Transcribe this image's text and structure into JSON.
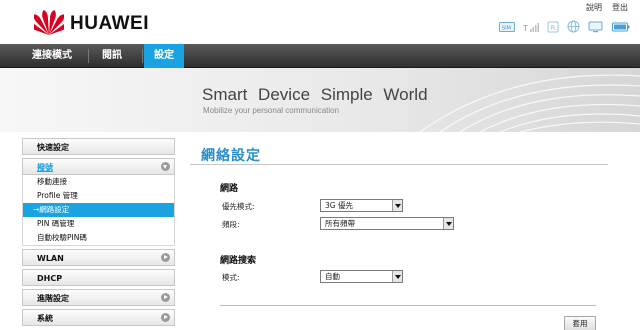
{
  "brand": {
    "name": "HUAWEI",
    "logo_icon": "huawei-petal-logo",
    "logo_color": "#d7001e"
  },
  "top_links": {
    "help": "說明",
    "logout": "登出"
  },
  "status_icons": [
    "sim-icon",
    "signal-icon",
    "roaming-icon",
    "globe-icon",
    "monitor-icon",
    "battery-icon"
  ],
  "nav": {
    "tabs": [
      "連接模式",
      "閱訊",
      "設定"
    ],
    "active": "設定",
    "active_color": "#1aa3e0"
  },
  "banner": {
    "title": "Smart Device   Simple World",
    "subtitle": "Mobilize your personal communication"
  },
  "sidebar": {
    "quick_setup": "快速設定",
    "dialup": {
      "label": "撥號",
      "items": [
        "移動連接",
        "Profile 管理",
        "網路設定",
        "PIN 碼管理",
        "自動校驗PIN碼"
      ],
      "active_item": "網路設定"
    },
    "wlan": "WLAN",
    "dhcp": "DHCP",
    "advanced": "進階設定",
    "system": "系統"
  },
  "content": {
    "title": "網絡設定",
    "network_section": "網路",
    "preferred_mode_label": "優先模式:",
    "preferred_mode_value": "3G 優先",
    "band_label": "頻段:",
    "band_value": "所有頻帶",
    "search_section": "網路搜索",
    "mode_label": "模式:",
    "mode_value": "自動",
    "apply_button": "套用"
  }
}
